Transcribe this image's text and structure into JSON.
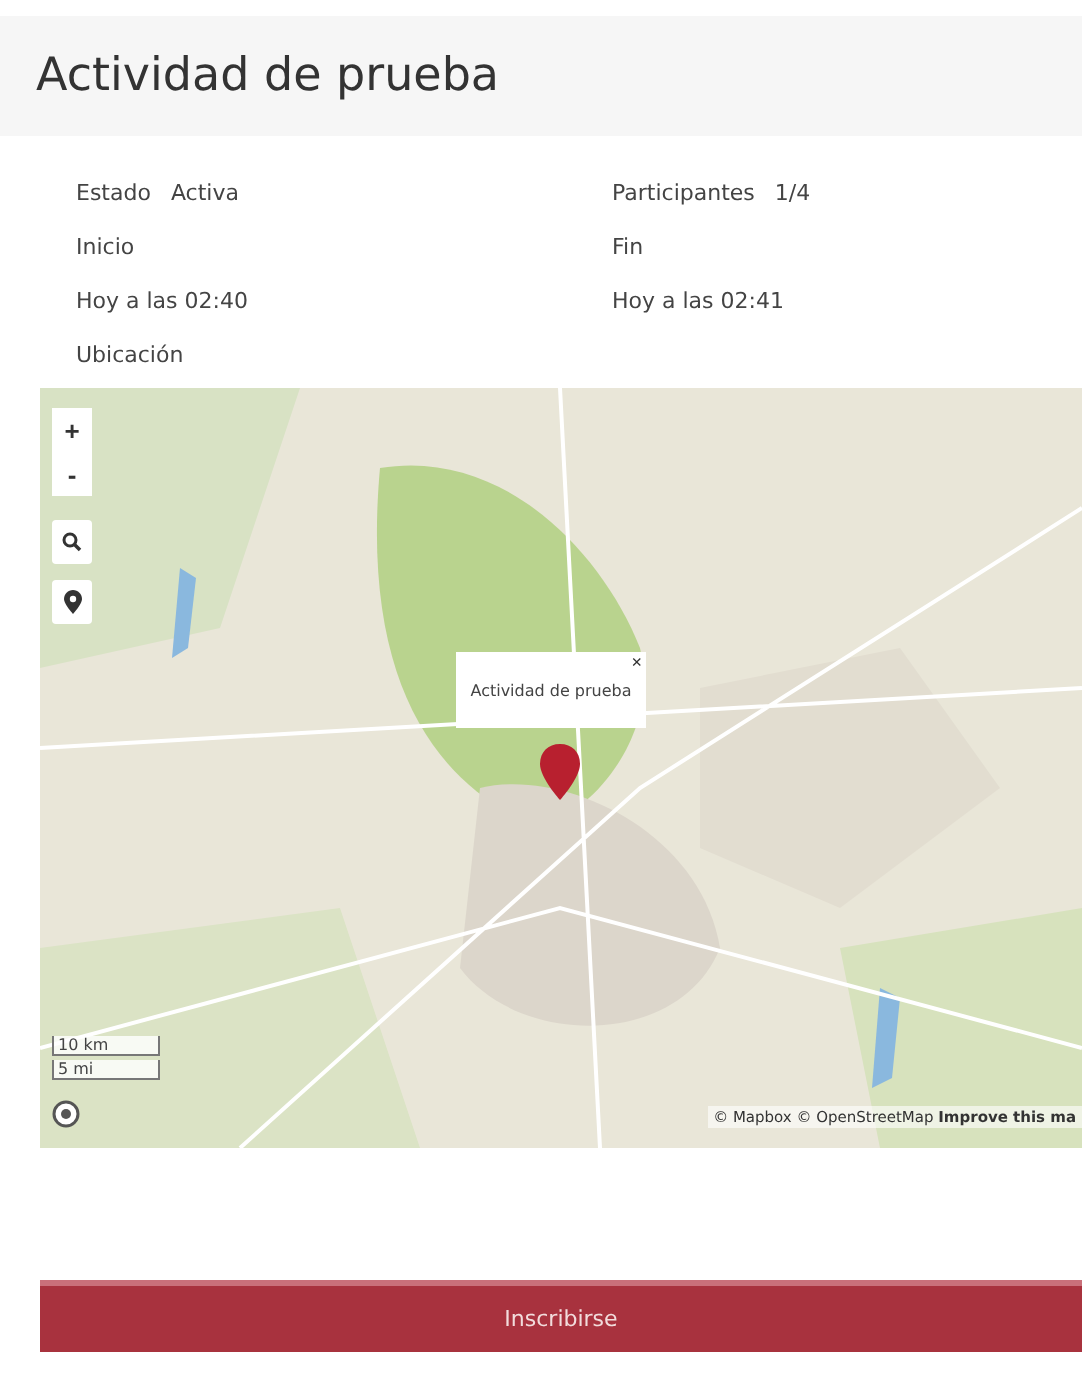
{
  "header": {
    "title": "Actividad de prueba"
  },
  "details": [
    {
      "label": "Estado",
      "value": "Activa"
    },
    {
      "label": "Participantes",
      "value": "1/4"
    }
  ],
  "times": [
    {
      "label": "Inicio",
      "value": "Hoy a las 02:40"
    },
    {
      "label": "Fin",
      "value": "Hoy a las 02:41"
    }
  ],
  "location": {
    "label": "Ubicación",
    "map": {
      "kind": "picture",
      "controls": [
        "+",
        "-"
      ],
      "popup": {
        "text": "Actividad de prueba",
        "close": "×"
      },
      "scale": [
        "10 km",
        "5 mi"
      ],
      "attribution": {
        "text": "© Mapbox © OpenStreetMap",
        "link": "Improve this ma"
      }
    }
  },
  "action": {
    "label": "Inscribirse"
  }
}
